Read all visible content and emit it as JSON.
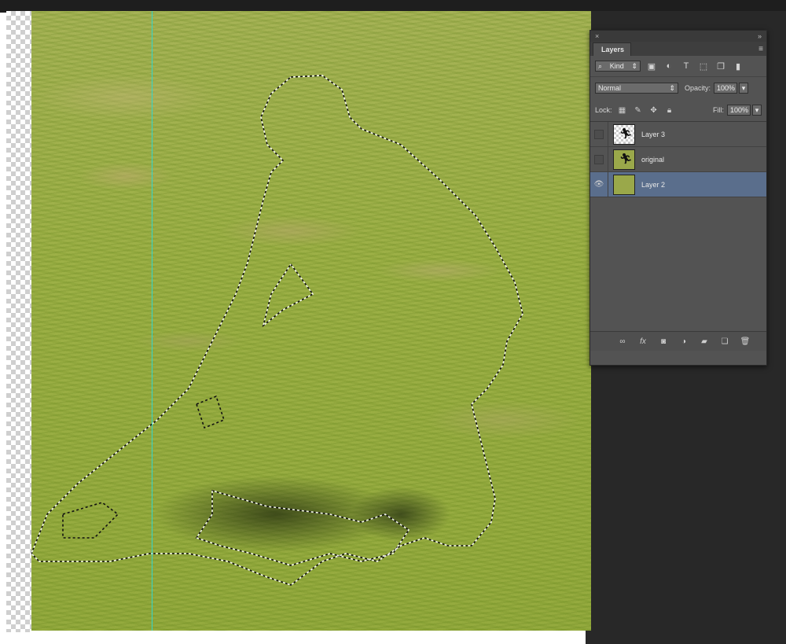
{
  "panel": {
    "collapse_glyph": "»",
    "close_glyph": "×",
    "tab_label": "Layers",
    "menu_glyph": "≡",
    "filter": {
      "search_glyph": "⌕",
      "kind_value": "Kind",
      "filter_icons": [
        "image-filter-icon",
        "adjustment-filter-icon",
        "type-filter-icon",
        "shape-filter-icon",
        "smart-object-filter-icon"
      ]
    },
    "blend_mode": "Normal",
    "opacity_label": "Opacity:",
    "opacity_value": "100%",
    "lock_label": "Lock:",
    "fill_label": "Fill:",
    "fill_value": "100%",
    "layers": [
      {
        "name": "Layer 3",
        "visible": false,
        "selected": false,
        "thumb": "checkered"
      },
      {
        "name": "original",
        "visible": false,
        "selected": false,
        "thumb": "grass"
      },
      {
        "name": "Layer 2",
        "visible": true,
        "selected": true,
        "thumb": "grass"
      }
    ],
    "bottom_icons": [
      "link-layers-icon",
      "fx-icon",
      "add-mask-icon",
      "adjustment-layer-icon",
      "new-group-icon",
      "new-layer-icon",
      "delete-layer-icon"
    ]
  },
  "colors": {
    "guide": "#33d6c8",
    "selected_layer": "#5a6e8c",
    "panel_bg": "#535353"
  }
}
